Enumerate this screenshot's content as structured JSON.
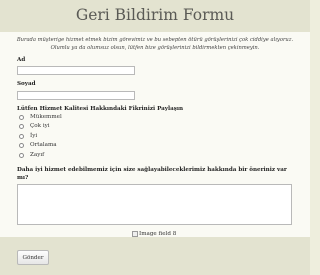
{
  "form": {
    "title": "Geri Bildirim Formu",
    "intro": "Burada müşterige hizmet etmek bizim görevimiz ve bu sebepten ötürü görüşlerinizi çok ciddiye alıyoruz. Olumlu ya da olumsuz olsun, lütfen bize görüşlerinizi bildirmekten çekinmeyin.",
    "fields": {
      "first_name_label": "Ad",
      "first_name_value": "",
      "last_name_label": "Soyad",
      "last_name_value": ""
    },
    "rating": {
      "label": "Lütfen Hizmet Kalitesi Hakkındaki Fikrinizi Paylaşın",
      "options": [
        "Mükemmel",
        "Çok iyi",
        "İyi",
        "Ortalama",
        "Zayıf"
      ]
    },
    "suggestion": {
      "label": "Daha iyi hizmet edebilmemiz için size sağlayabileceklerimiz hakkında bir öneriniz var mı?",
      "value": ""
    },
    "image_field_alt": "Image field 8",
    "submit_label": "Gönder"
  }
}
